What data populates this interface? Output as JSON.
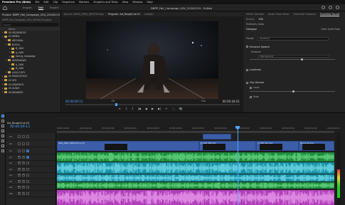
{
  "menubar": {
    "app": "Premiere Pro (Beta)",
    "items": [
      "File",
      "Edit",
      "Clip",
      "Sequence",
      "Markers",
      "Graphics and Titles",
      "View",
      "Window",
      "Help"
    ]
  },
  "topbar": {
    "tabs": [
      "Import",
      "Edit",
      "Export"
    ],
    "active_tab": "Edit",
    "title": "DBPP_Fall_Campaign_US4_20240119 - Edited"
  },
  "project": {
    "tab": "Project: DBPP_Fall_Campaign_US4_20240119",
    "path": "DBPP_Fall_Campaign_US4_20240119.prproj",
    "search_placeholder": "Search",
    "col_name": "Name",
    "bins": [
      {
        "level": 0,
        "name": "00 SEQUENCES",
        "type": "folder"
      },
      {
        "level": 0,
        "name": "01 MEDIA",
        "type": "folder"
      },
      {
        "level": 1,
        "name": "ARCHIVAL",
        "type": "folder"
      },
      {
        "level": 1,
        "name": "B-ROLL",
        "type": "folder"
      },
      {
        "level": 2,
        "name": "B_CAM",
        "type": "folder"
      },
      {
        "level": 2,
        "name": "A_CAM",
        "type": "folder"
      },
      {
        "level": 2,
        "name": "Spring_Campaign",
        "type": "folder"
      },
      {
        "level": 1,
        "name": "INTERVIEWS",
        "type": "folder"
      },
      {
        "level": 2,
        "name": "A_CAM",
        "type": "folder"
      },
      {
        "level": 2,
        "name": "B_CAM",
        "type": "folder"
      },
      {
        "level": 1,
        "name": "LOGS COPY",
        "type": "folder"
      },
      {
        "level": 0,
        "name": "02 MUSIC/VOICE",
        "type": "folder"
      },
      {
        "level": 0,
        "name": "03 SFX",
        "type": "folder"
      },
      {
        "level": 0,
        "name": "04 GRAPHICS",
        "type": "folder"
      },
      {
        "level": 0,
        "name": "05 AUDIO",
        "type": "folder"
      },
      {
        "level": 0,
        "name": "06 RENDERS",
        "type": "folder"
      }
    ]
  },
  "monitor": {
    "tabs": [
      "Source: A001_R001_0R2FOF.mov",
      "Program: Ad_RoughCut-V2",
      "Lumetri"
    ],
    "active_tab": "Program: Ad_RoughCut-V2",
    "timecode_in": "00:00:09:13",
    "fit": "Fit",
    "full": "Full",
    "timecode_out": "00:00:44:01",
    "controls": [
      "⇤",
      "{",
      "}",
      "|◀",
      "◀",
      "▶",
      "▶|",
      "↵",
      "⬚",
      "📷"
    ]
  },
  "sound": {
    "tabs": [
      "Effect Controls",
      "Audio Track Mixer",
      "Essential Graphics",
      "Essential Sound"
    ],
    "active_tab": "Essential Sound",
    "sub_tabs": [
      "Browse",
      "Edit"
    ],
    "active_sub": "Edit",
    "clip_name": "Multicam_Gaiko",
    "type_label": "Dialogue",
    "clear_label": "Clear Audio Type",
    "preset_label": "Preset:",
    "preset_value": "(Custom)",
    "enhance_speech": "Enhance Speech",
    "enhance_mode": "Enhance",
    "enhance_dd": "Mix Amount",
    "loudness": "Loudness",
    "clip_volume": "Clip Volume",
    "level": "Level",
    "mute": "Mute"
  },
  "timeline": {
    "tab": "Ad_RoughCut-V2",
    "timecode": "00:00:09:13",
    "ruler_ticks": [
      "00:00:00:00",
      "00:00:02:00",
      "00:00:04:00",
      "00:00:06:00",
      "00:00:08:00",
      "00:00:10:00",
      "00:00:12:00",
      "00:00:14:00",
      "00:00:16:00",
      "00:00:18:00",
      "00:00:20:00",
      "00:00:22:00",
      "00:00:24:00"
    ],
    "tracks": [
      "V3",
      "V2",
      "V1",
      "A1",
      "A2",
      "A3",
      "A4",
      "A5",
      "A6",
      "Mix"
    ],
    "video_clips": [
      {
        "label": "A001_R001_0R2FOF.mov [V]"
      },
      {
        "label": "B_CAM_004.mov"
      },
      {
        "label": "A_CAM_012.mov"
      },
      {
        "label": "Spring_02.mov"
      }
    ],
    "playhead_percent": 65
  },
  "colors": {
    "accent": "#4fa3ff",
    "video_clip": "#3c5ea8",
    "audio_green": "#1c8a3a",
    "audio_teal": "#1690a4",
    "audio_pink": "#b03fb8",
    "folder": "#c9a14a"
  }
}
